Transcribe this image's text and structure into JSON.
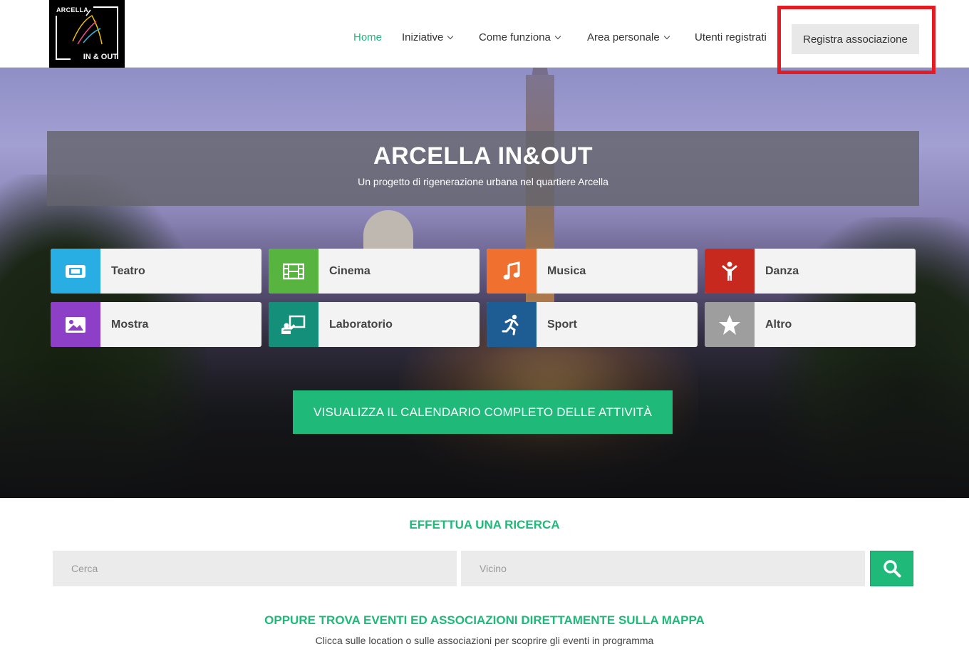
{
  "header": {
    "logo": {
      "line1": "ARCELLA",
      "line2": "IN & OUT"
    },
    "nav": [
      {
        "label": "Home",
        "active": true,
        "dropdown": false
      },
      {
        "label": "Iniziative",
        "active": false,
        "dropdown": true
      },
      {
        "label": "Come funziona",
        "active": false,
        "dropdown": true
      },
      {
        "label": "Area personale",
        "active": false,
        "dropdown": true
      },
      {
        "label": "Utenti registrati",
        "active": false,
        "dropdown": false
      }
    ],
    "register_button": "Registra associazione"
  },
  "hero": {
    "title": "ARCELLA IN&OUT",
    "subtitle": "Un progetto di rigenerazione urbana nel quartiere Arcella",
    "categories": [
      {
        "label": "Teatro",
        "icon": "ticket-icon",
        "color": "#29aee3"
      },
      {
        "label": "Cinema",
        "icon": "film-icon",
        "color": "#57b43f"
      },
      {
        "label": "Musica",
        "icon": "music-note-icon",
        "color": "#f07030"
      },
      {
        "label": "Danza",
        "icon": "dancer-icon",
        "color": "#c8291e"
      },
      {
        "label": "Mostra",
        "icon": "image-icon",
        "color": "#8e3fc8"
      },
      {
        "label": "Laboratorio",
        "icon": "presentation-icon",
        "color": "#14907a"
      },
      {
        "label": "Sport",
        "icon": "runner-icon",
        "color": "#1e5d94"
      },
      {
        "label": "Altro",
        "icon": "star-icon",
        "color": "#9e9e9e"
      }
    ],
    "calendar_button": "VISUALIZZA IL CALENDARIO COMPLETO DELLE ATTIVITÀ"
  },
  "search": {
    "title": "EFFETTUA UNA RICERCA",
    "query_placeholder": "Cerca",
    "near_placeholder": "Vicino"
  },
  "map": {
    "title": "OPPURE TROVA EVENTI ED ASSOCIAZIONI DIRETTAMENTE SULLA MAPPA",
    "subtitle": "Clicca sulle location o sulle associazioni per scoprire gli eventi in programma"
  },
  "colors": {
    "accent": "#1fb97a",
    "highlight": "#e31b23"
  }
}
